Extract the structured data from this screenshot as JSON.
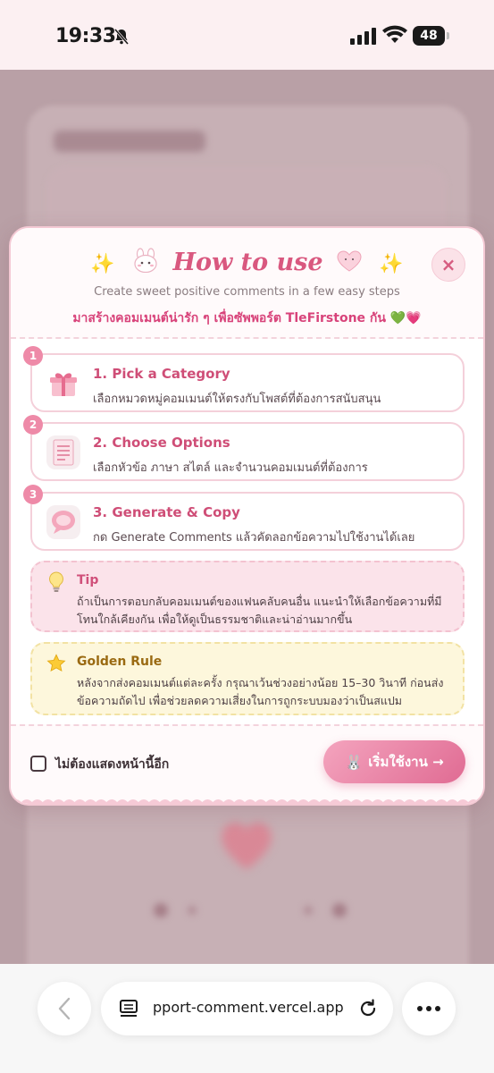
{
  "status_bar": {
    "time": "19:33",
    "battery": "48"
  },
  "browser": {
    "url": "pport-comment.vercel.app"
  },
  "modal": {
    "title": "How to use",
    "subtitle": "Create sweet positive comments in a few easy steps",
    "thai_subtitle": "มาสร้างคอมเมนต์น่ารัก ๆ เพื่อซัพพอร์ต TleFirstone กัน 💚💗",
    "close_label": "×",
    "steps": [
      {
        "number": "1",
        "title": "1. Pick a Category",
        "desc": "เลือกหมวดหมู่คอมเมนต์ให้ตรงกับโพสต์ที่ต้องการสนับสนุน",
        "icon": "gift-icon"
      },
      {
        "number": "2",
        "title": "2. Choose Options",
        "desc": "เลือกหัวข้อ ภาษา สไตล์ และจำนวนคอมเมนต์ที่ต้องการ",
        "icon": "notepad-icon"
      },
      {
        "number": "3",
        "title": "3. Generate & Copy",
        "desc": "กด Generate Comments แล้วคัดลอกข้อความไปใช้งานได้เลย",
        "icon": "speech-bubble-icon"
      }
    ],
    "tip": {
      "title": "Tip",
      "text": "ถ้าเป็นการตอบกลับคอมเมนต์ของแฟนคลับคนอื่น แนะนำให้เลือกข้อความที่มีโทนใกล้เคียงกัน เพื่อให้ดูเป็นธรรมชาติและน่าอ่านมากขึ้น"
    },
    "golden_rule": {
      "title": "Golden Rule",
      "text": "หลังจากส่งคอมเมนต์แต่ละครั้ง กรุณาเว้นช่วงอย่างน้อย 15–30 วินาที ก่อนส่งข้อความถัดไป เพื่อช่วยลดความเสี่ยงในการถูกระบบมองว่าเป็นสแปม"
    },
    "dont_show_label": "ไม่ต้องแสดงหน้านี้อีก",
    "start_label": "เริ่มใช้งาน →"
  },
  "colors": {
    "accent": "#d9587f",
    "primary_button": "#e06b93",
    "tip_bg": "#fbe3ea",
    "rule_bg": "#fdf7dc"
  }
}
